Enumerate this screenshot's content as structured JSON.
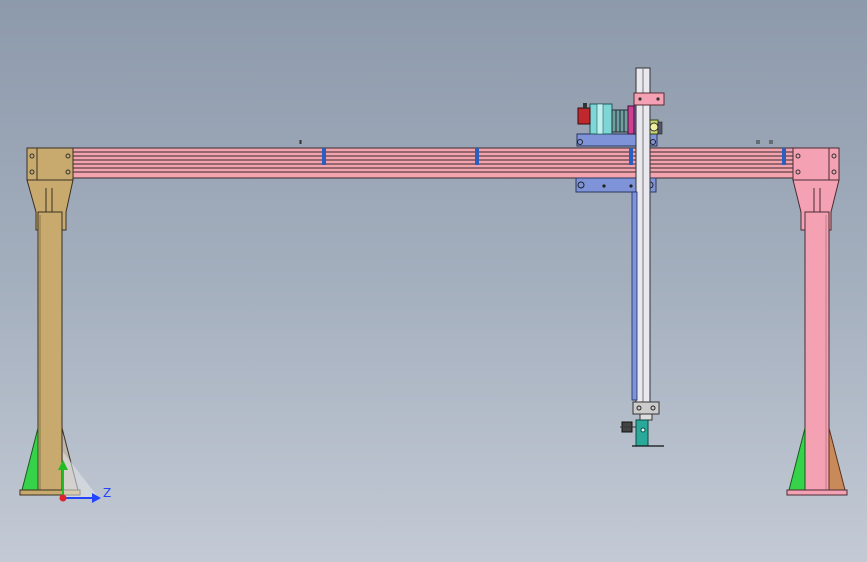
{
  "scene": {
    "type": "gantry-robot-cad-front-view",
    "background": {
      "top": "#8d9aab",
      "bottom": "#c3cad5"
    }
  },
  "colors": {
    "beam": "#f2a3ad",
    "beam_line": "#3a2a30",
    "left_column": "#c8aa6e",
    "right_column": "#f4a1b4",
    "gusset_green": "#35d24a",
    "gusset_brown": "#c98a5a",
    "carriage_plate": "#7f94d8",
    "vertical_axis": "#e8e8ee",
    "motor_cyan": "#7fd6d6",
    "gripper_teal": "#2aa99b",
    "clip_blue": "#2a5fbf"
  },
  "triad": {
    "z_label": "Z",
    "x_color": "#2244ff",
    "y_color": "#22bb22",
    "origin_color": "#e0222a"
  }
}
